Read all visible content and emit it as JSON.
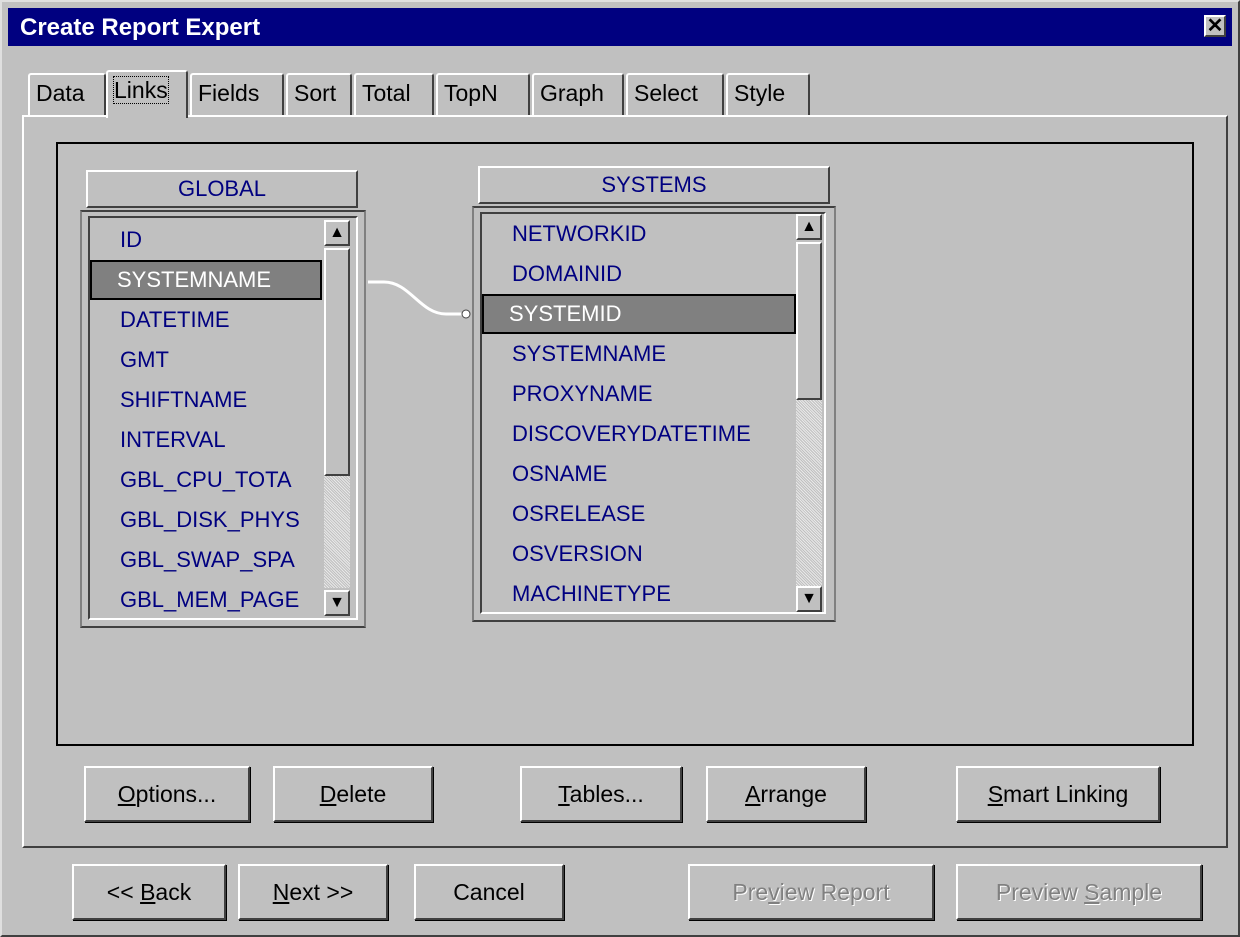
{
  "window": {
    "title": "Create Report Expert",
    "close_glyph": "✕"
  },
  "tabs": [
    "Data",
    "Links",
    "Fields",
    "Sort",
    "Total",
    "TopN",
    "Graph",
    "Select",
    "Style"
  ],
  "active_tab": "Links",
  "tables": {
    "global": {
      "name": "GLOBAL",
      "fields": [
        "ID",
        "SYSTEMNAME",
        "DATETIME",
        "GMT",
        "SHIFTNAME",
        "INTERVAL",
        "GBL_CPU_TOTA",
        "GBL_DISK_PHYS",
        "GBL_SWAP_SPA",
        "GBL_MEM_PAGE"
      ],
      "selected": "SYSTEMNAME"
    },
    "systems": {
      "name": "SYSTEMS",
      "fields": [
        "NETWORKID",
        "DOMAINID",
        "SYSTEMID",
        "SYSTEMNAME",
        "PROXYNAME",
        "DISCOVERYDATETIME",
        "OSNAME",
        "OSRELEASE",
        "OSVERSION",
        "MACHINETYPE"
      ],
      "selected": "SYSTEMID"
    }
  },
  "link": {
    "from": "GLOBAL.SYSTEMNAME",
    "to": "SYSTEMS.SYSTEMID"
  },
  "panel_buttons": {
    "options": {
      "label": "Options...",
      "mnemonic": "O"
    },
    "delete": {
      "label": "Delete",
      "mnemonic": "D"
    },
    "tables": {
      "label": "Tables...",
      "mnemonic": "T"
    },
    "arrange": {
      "label": "Arrange",
      "mnemonic": "A"
    },
    "smart_linking": {
      "label": "Smart Linking",
      "mnemonic": "S"
    }
  },
  "footer_buttons": {
    "back": {
      "label": "<< Back",
      "mnemonic": "B"
    },
    "next": {
      "label": "Next >>",
      "mnemonic": "N"
    },
    "cancel": {
      "label": "Cancel"
    },
    "preview_report": {
      "label": "Preview Report",
      "mnemonic": "v",
      "enabled": false
    },
    "preview_sample": {
      "label": "Preview Sample",
      "mnemonic": "S",
      "enabled": false
    }
  },
  "icons": {
    "scroll_up": "▲",
    "scroll_down": "▼"
  }
}
